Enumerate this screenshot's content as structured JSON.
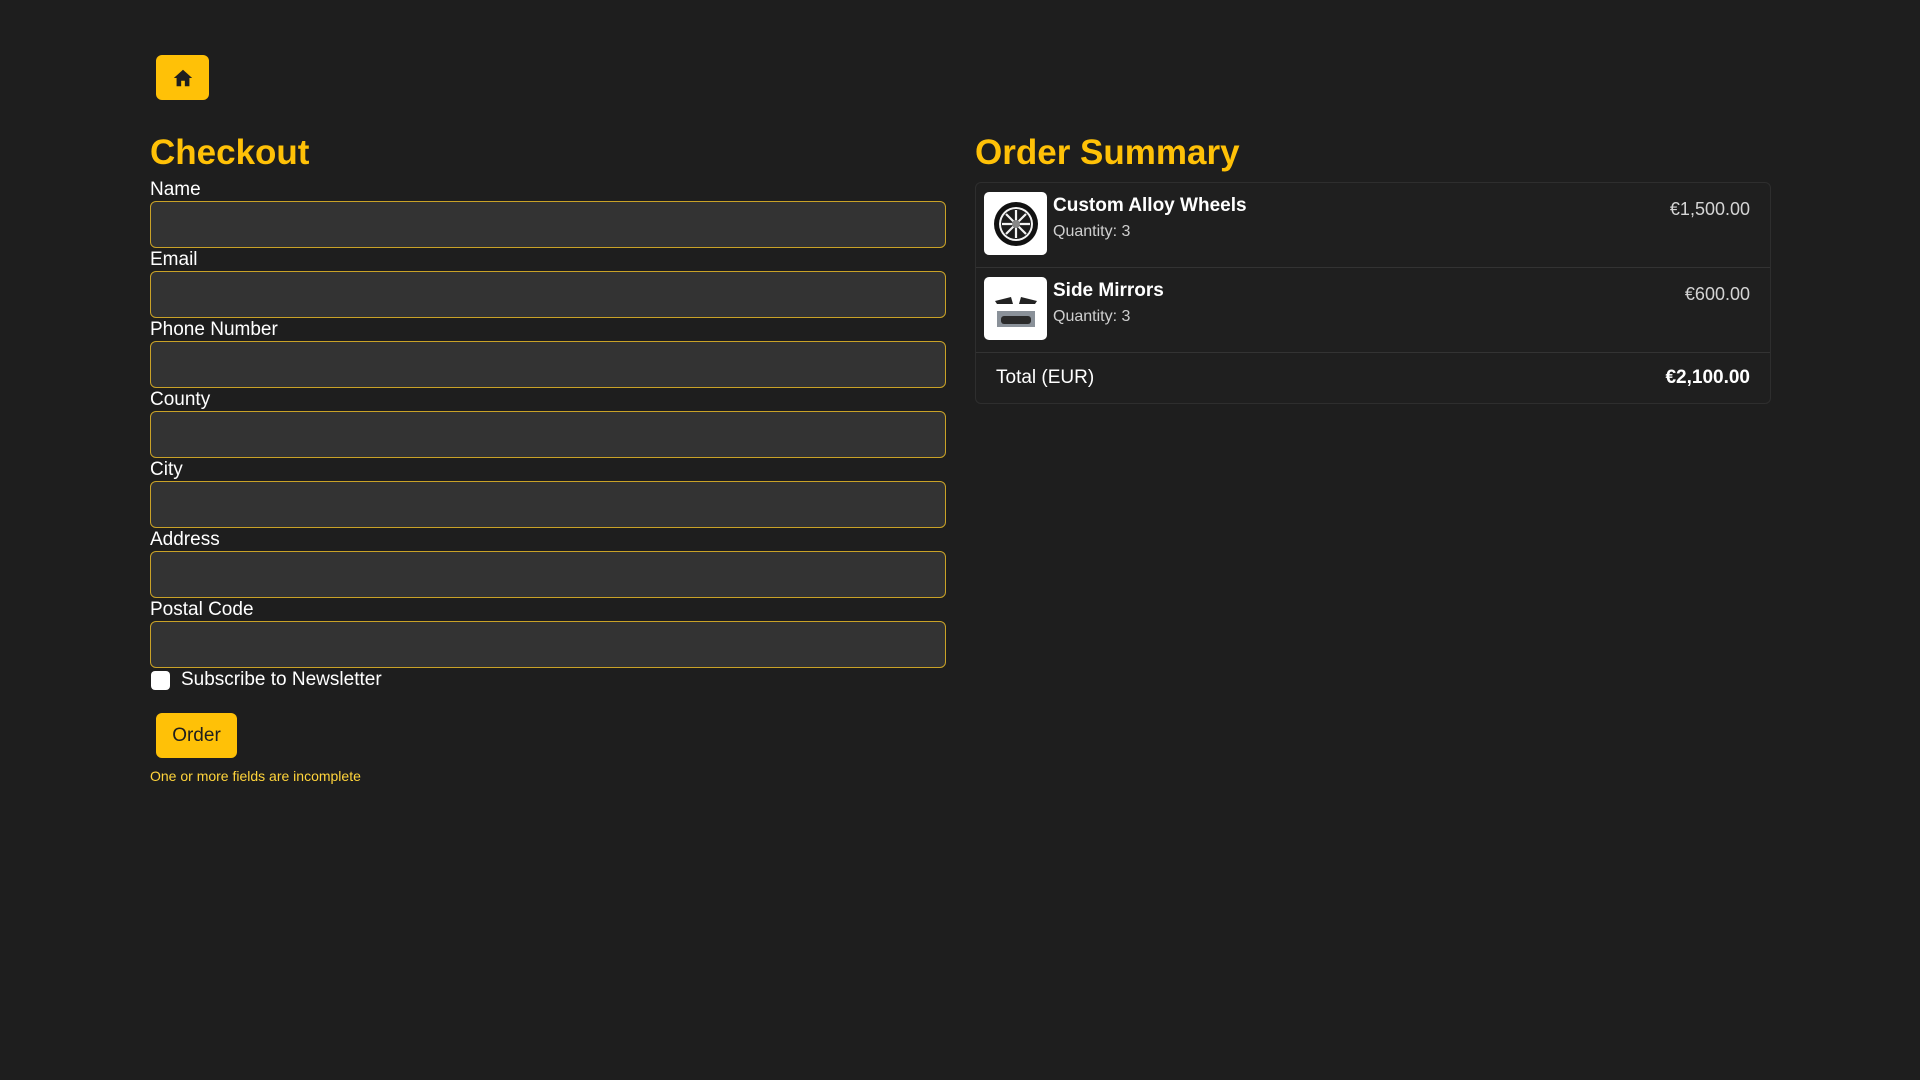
{
  "nav": {
    "home_icon": "home-icon",
    "accent_color": "#ffc107"
  },
  "checkout": {
    "title": "Checkout",
    "fields": {
      "name": {
        "label": "Name",
        "value": ""
      },
      "email": {
        "label": "Email",
        "value": ""
      },
      "phone": {
        "label": "Phone Number",
        "value": ""
      },
      "county": {
        "label": "County",
        "value": ""
      },
      "city": {
        "label": "City",
        "value": ""
      },
      "address": {
        "label": "Address",
        "value": ""
      },
      "postal_code": {
        "label": "Postal Code",
        "value": ""
      }
    },
    "newsletter": {
      "label": "Subscribe to Newsletter",
      "checked": false
    },
    "order_button": "Order",
    "error": "One or more fields are incomplete"
  },
  "summary": {
    "title": "Order Summary",
    "items": [
      {
        "name": "Custom Alloy Wheels",
        "quantity": "Quantity: 3",
        "price": "€1,500.00",
        "icon": "alloy-wheel-image"
      },
      {
        "name": "Side Mirrors",
        "quantity": "Quantity: 3",
        "price": "€600.00",
        "icon": "side-mirrors-image"
      }
    ],
    "total_label": "Total (EUR)",
    "total_value": "€2,100.00"
  }
}
